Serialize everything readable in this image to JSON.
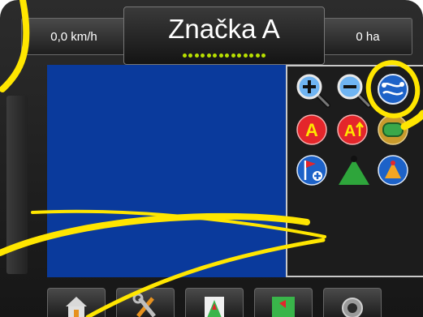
{
  "header": {
    "speed": "0,0 km/h",
    "title": "Značka A",
    "area": "0 ha",
    "indicator_dot_count": 14
  },
  "colors": {
    "map": "#0a3a9c",
    "callout": "#ffe600",
    "indicator": "#b8e000",
    "palette_blue": "#1d62c8",
    "palette_red": "#e4262b",
    "palette_green": "#2ea53b"
  },
  "tool_palette": {
    "buttons": [
      {
        "name": "zoom-in-icon"
      },
      {
        "name": "zoom-out-icon"
      },
      {
        "name": "curved-guideline-icon",
        "highlighted": true
      },
      {
        "name": "mark-a-icon",
        "label": "A"
      },
      {
        "name": "mark-a-plus-icon",
        "label": "A+"
      },
      {
        "name": "boundary-icon"
      },
      {
        "name": "add-poi-flag-icon"
      },
      {
        "name": "vehicle-perspective-icon"
      },
      {
        "name": "overhead-view-icon"
      }
    ]
  },
  "bottom_tabs": [
    {
      "name": "home-icon"
    },
    {
      "name": "tools-icon"
    },
    {
      "name": "vehicle-view-icon"
    },
    {
      "name": "map-view-icon"
    },
    {
      "name": "camera-icon"
    }
  ]
}
